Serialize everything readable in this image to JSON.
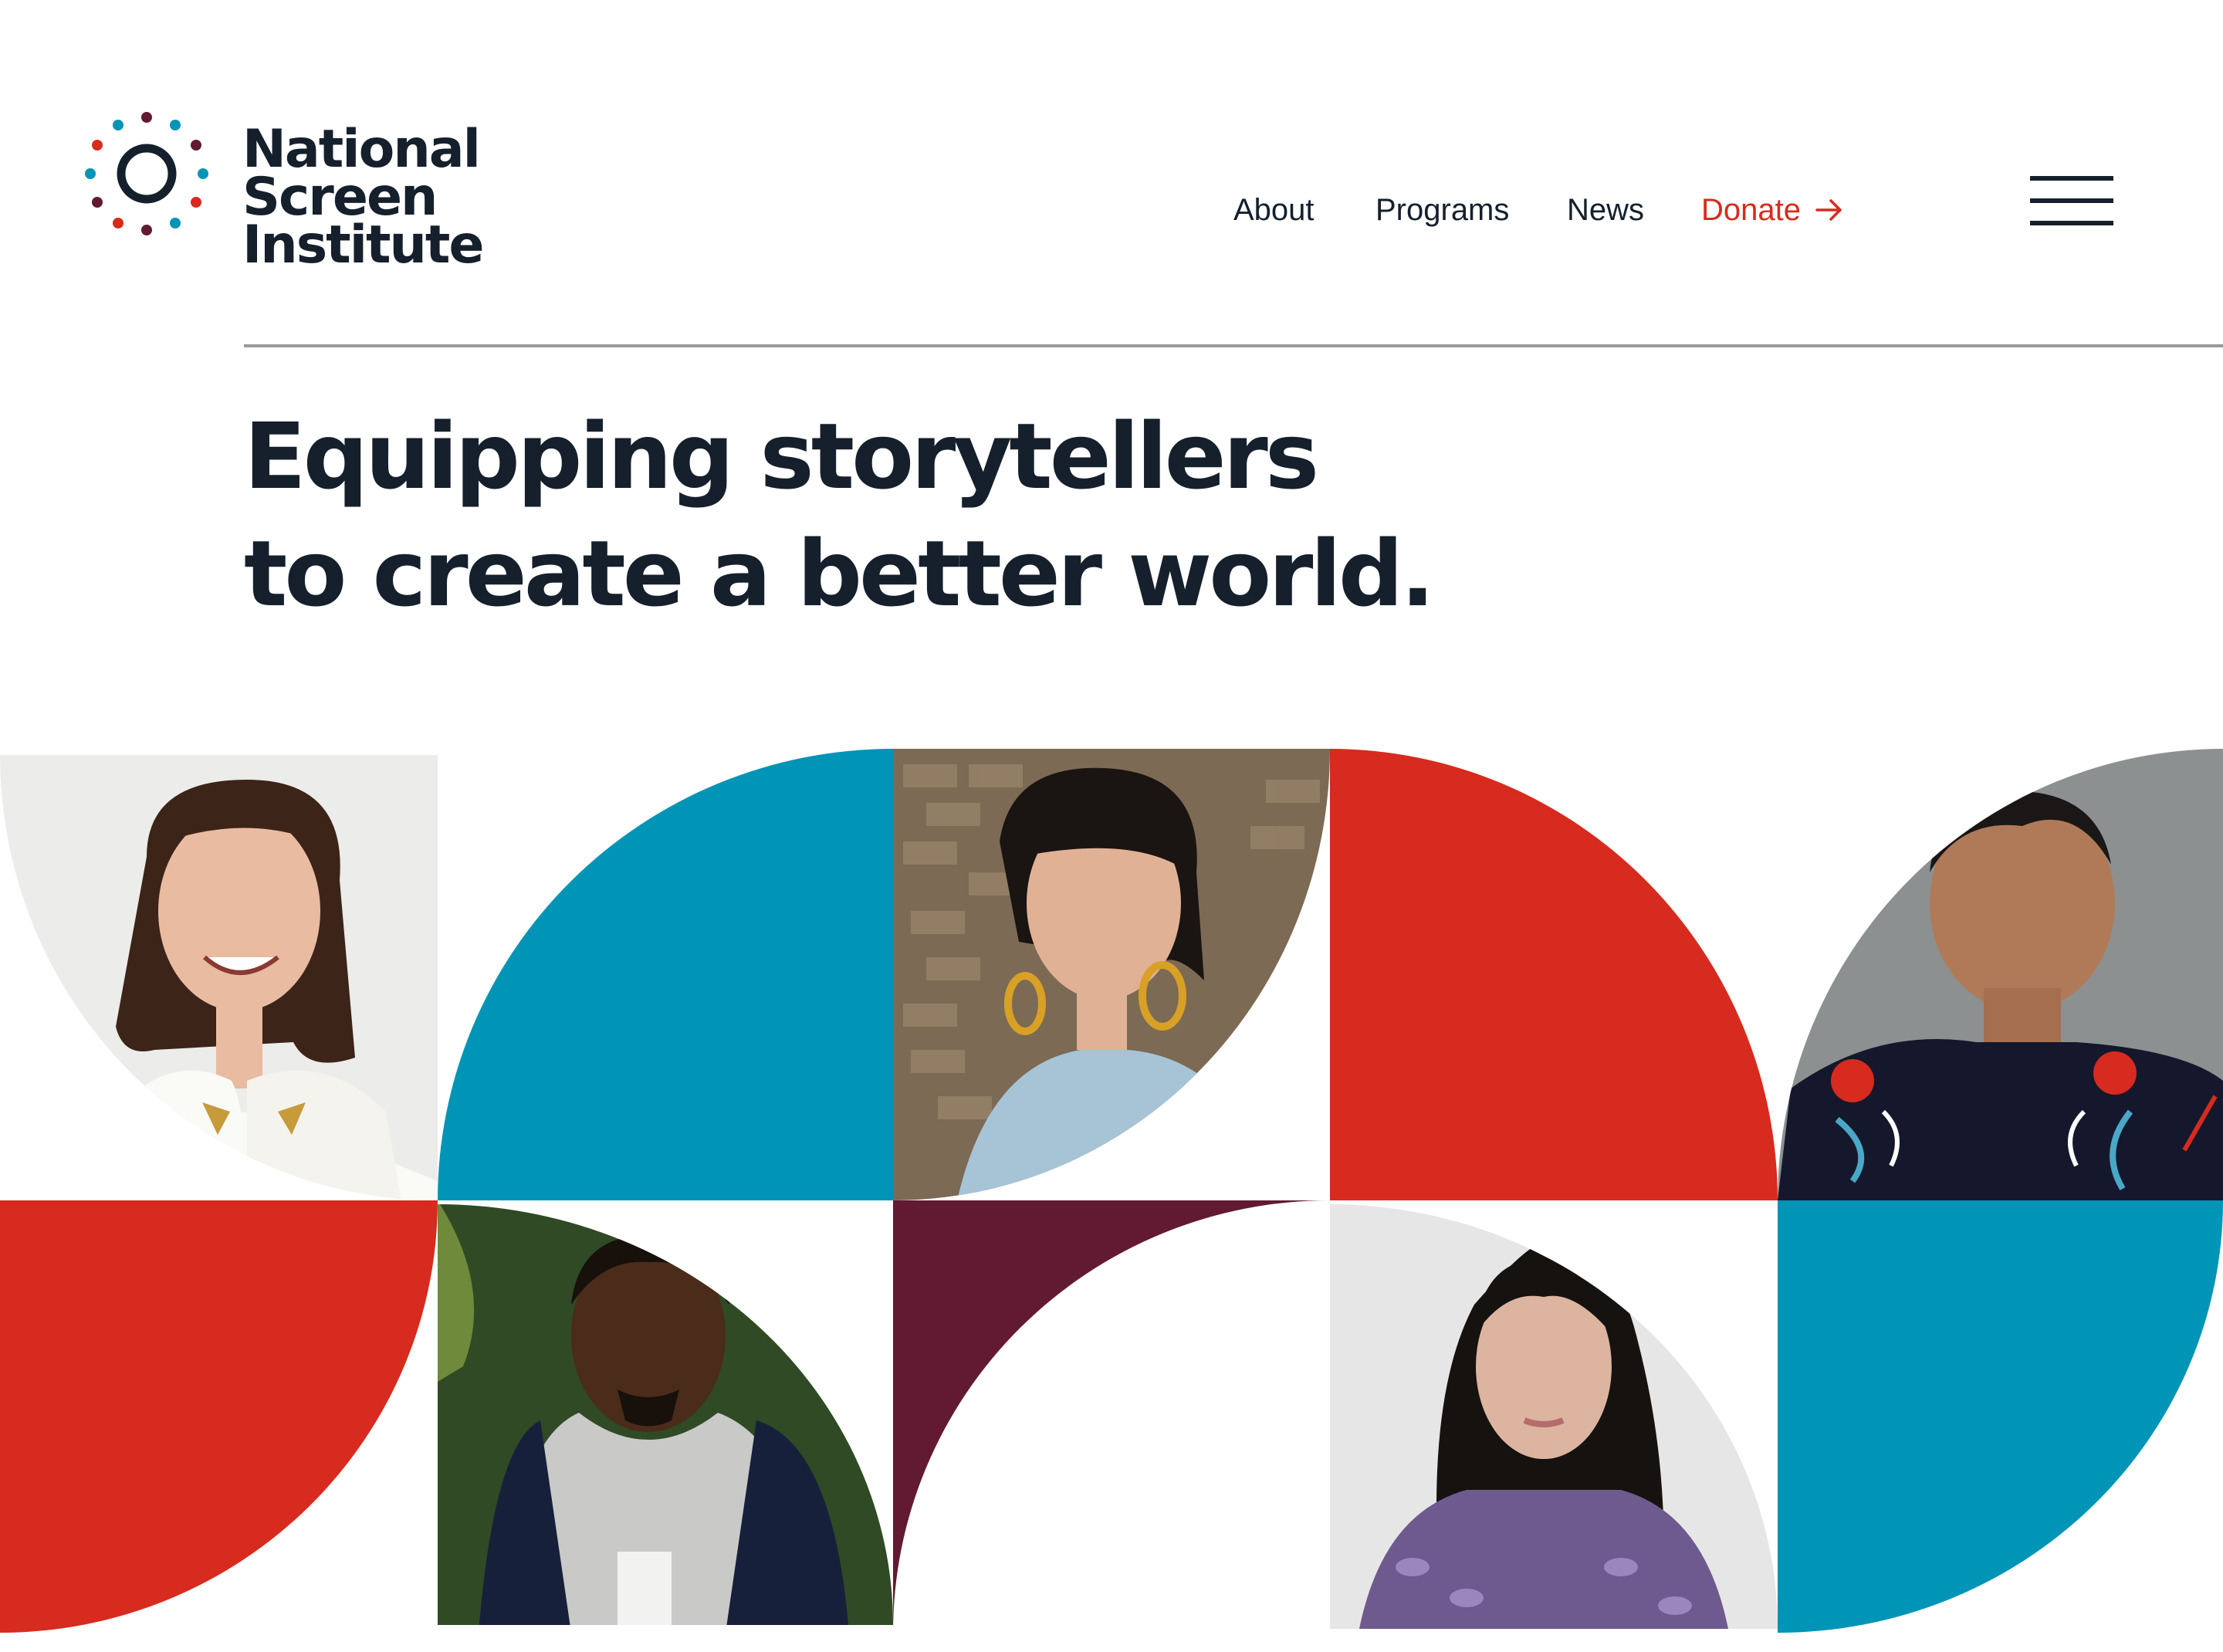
{
  "brand": {
    "name_line1": "National Screen",
    "name_line2": "Institute",
    "colors": {
      "teal": "#0094b6",
      "red": "#d62b1e",
      "maroon": "#621a32",
      "navy": "#15202c"
    }
  },
  "nav": {
    "items": [
      {
        "label": "About"
      },
      {
        "label": "Programs"
      },
      {
        "label": "News"
      },
      {
        "label": "Donate"
      }
    ],
    "donate_icon": "arrow-right-icon",
    "menu_icon": "hamburger-menu-icon"
  },
  "hero": {
    "headline_line1": "Equipping storytellers",
    "headline_line2": "to create a better world."
  }
}
